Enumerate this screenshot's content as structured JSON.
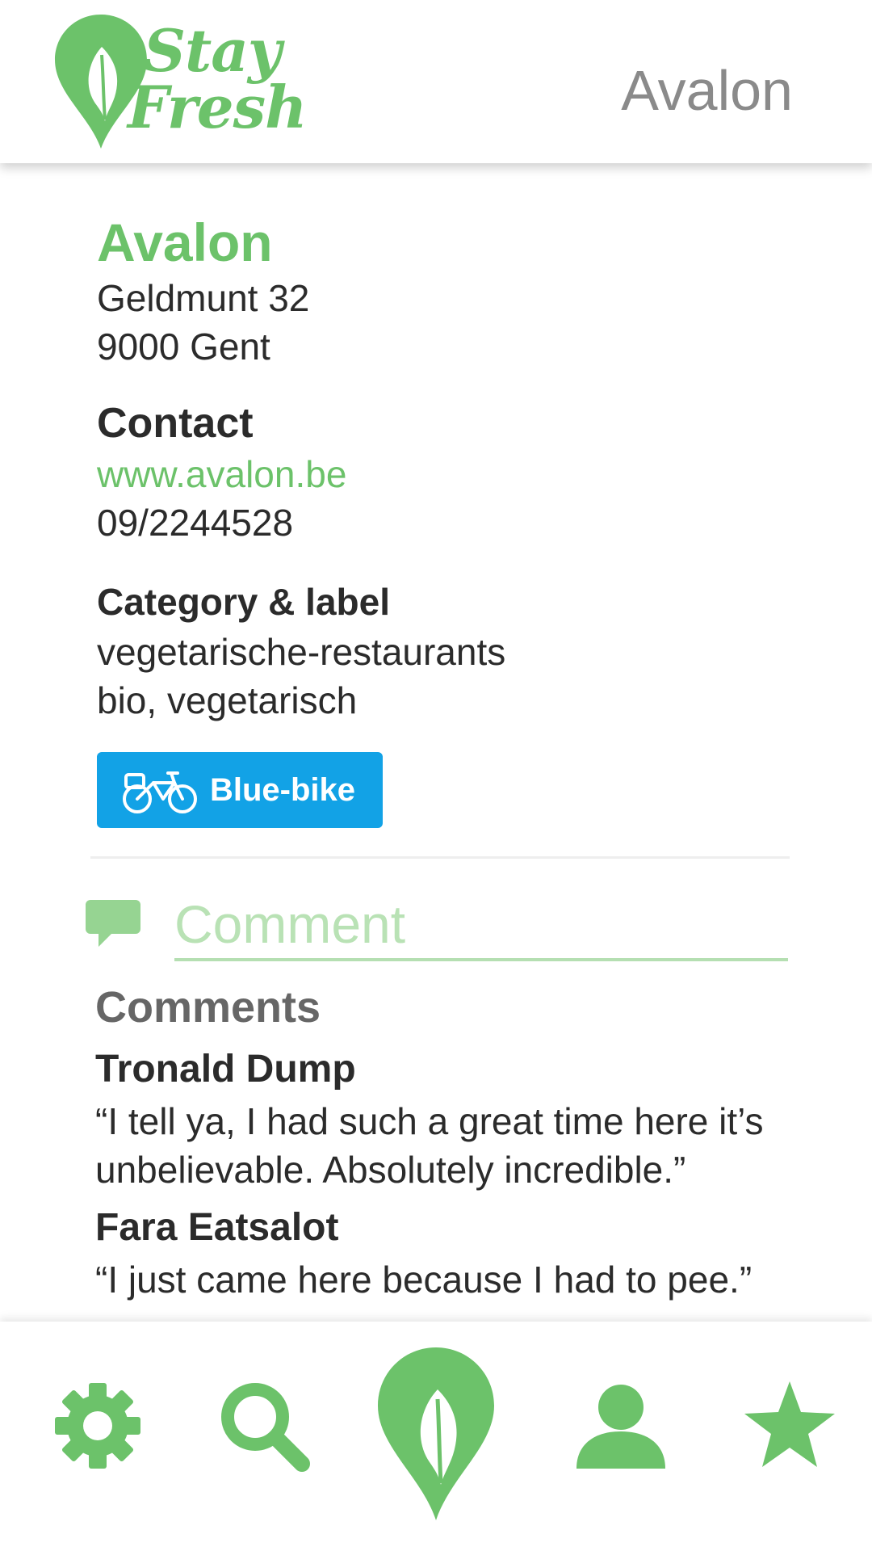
{
  "app": {
    "logo_text_line1": "Stay",
    "logo_text_line2": "Fresh",
    "header_title": "Avalon"
  },
  "place": {
    "name": "Avalon",
    "address_line1": "Geldmunt 32",
    "address_line2": "9000 Gent"
  },
  "contact": {
    "title": "Contact",
    "website": "www.avalon.be",
    "phone": "09/2244528"
  },
  "category": {
    "title": "Category & label",
    "category": "vegetarische-restaurants",
    "labels": "bio, vegetarisch"
  },
  "bluebike": {
    "label": "Blue-bike"
  },
  "comment_input": {
    "placeholder": "Comment"
  },
  "comments": {
    "heading": "Comments",
    "items": [
      {
        "author": "Tronald Dump",
        "text": "“I tell ya, I had such a great time here it’s unbelievable. Absolutely incredible.”"
      },
      {
        "author": "Fara Eatsalot",
        "text": "“I just came here because I had to pee.”"
      }
    ]
  },
  "nav": {
    "items": [
      "settings",
      "search",
      "map",
      "profile",
      "favorites"
    ]
  },
  "colors": {
    "accent": "#6cc26a",
    "accent_light": "#b9e2b5",
    "bluebike": "#12a2e6",
    "text": "#2b2b2b",
    "header_title": "#8a8a8a"
  }
}
